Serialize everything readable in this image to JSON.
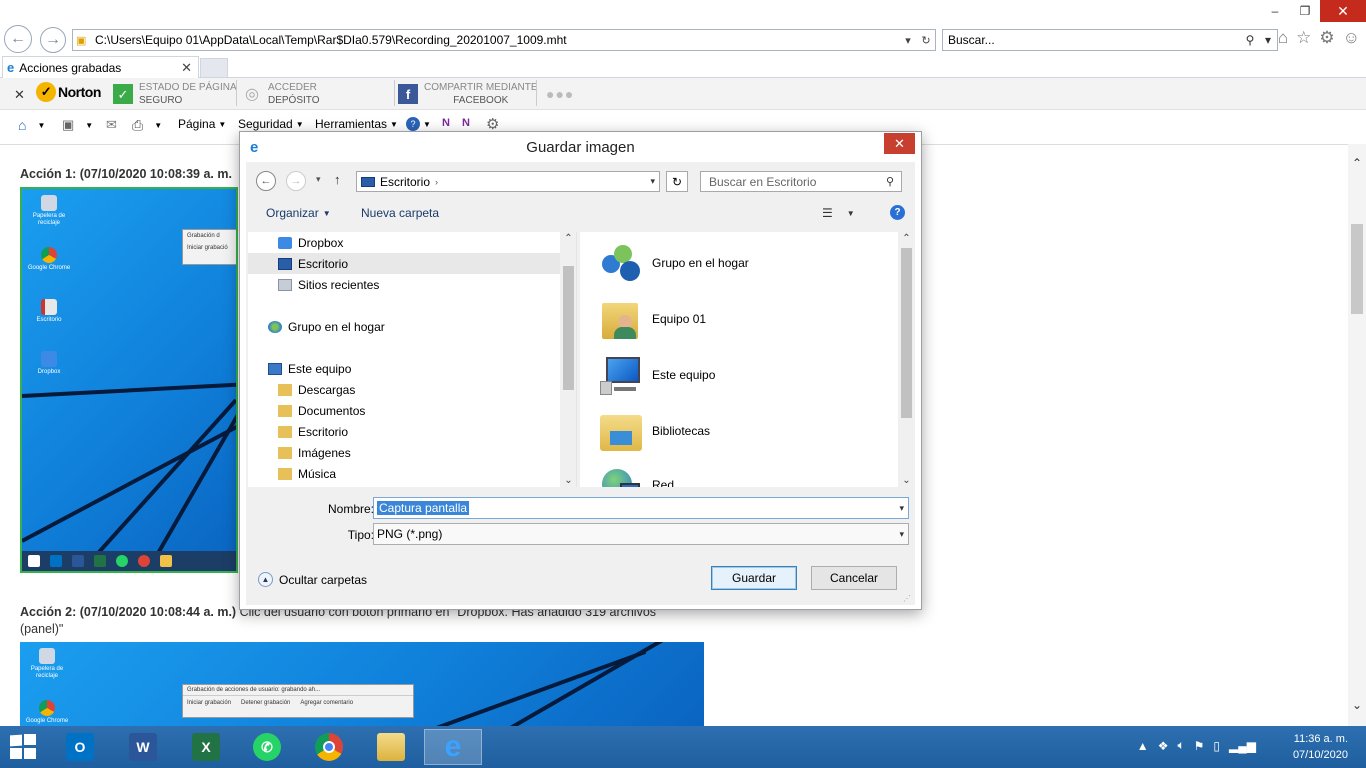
{
  "browser": {
    "address": "C:\\Users\\Equipo 01\\AppData\\Local\\Temp\\Rar$DIa0.579\\Recording_20201007_1009.mht",
    "search_placeholder": "Buscar...",
    "tab_title": "Acciones grabadas",
    "window_controls": {
      "minimize": "–",
      "maximize": "❐",
      "close": "✕"
    },
    "toolbar_icons": [
      "home-icon",
      "star-icon",
      "gear-icon",
      "smiley-icon"
    ]
  },
  "norton": {
    "logo_text": "Norton",
    "page_state_l1": "ESTADO DE PÁGINA",
    "page_state_l2": "SEGURO",
    "access_l1": "ACCEDER",
    "access_l2": "DEPÓSITO",
    "share_l1": "COMPARTIR MEDIANTE",
    "share_l2": "FACEBOOK",
    "accent": "#f4b400",
    "safe_color": "#3bab4a"
  },
  "commandbar": {
    "page": "Página",
    "security": "Seguridad",
    "tools": "Herramientas"
  },
  "content": {
    "action1_title": "Acción 1: (07/10/2020 10:08:39 a. m.",
    "action2_title": "Acción 2: (07/10/2020 10:08:44 a. m.)",
    "action2_rest": " Clic del usuario con botón primario en \"Dropbox. Has añadido 319 archivos",
    "action2_line2": "(panel)\"",
    "desk_icons": [
      "Papelera de reciclaje",
      "Google Chrome",
      "Escritorio",
      "Dropbox"
    ],
    "mini_rec1": "Grabación d",
    "mini_rec2": "Iniciar grabació",
    "mini_rec_title": "Grabación de acciones de usuario: grabando ah...",
    "mini_rec_start": "Iniciar grabación",
    "mini_rec_stop": "Detener grabación",
    "mini_rec_comment": "Agregar comentario"
  },
  "dialog": {
    "title": "Guardar imagen",
    "close": "✕",
    "breadcrumb": "Escritorio",
    "search_placeholder": "Buscar en Escritorio",
    "organize": "Organizar",
    "new_folder": "Nueva carpeta",
    "help": "?",
    "nav_items": [
      {
        "label": "Dropbox",
        "icon": "dropbox-icon"
      },
      {
        "label": "Escritorio",
        "icon": "desktop-icon"
      },
      {
        "label": "Sitios recientes",
        "icon": "recent-places-icon"
      },
      {
        "label": "Grupo en el hogar",
        "icon": "homegroup-icon"
      },
      {
        "label": "Este equipo",
        "icon": "computer-icon"
      },
      {
        "label": "Descargas",
        "icon": "folder-icon"
      },
      {
        "label": "Documentos",
        "icon": "folder-icon"
      },
      {
        "label": "Escritorio",
        "icon": "folder-icon"
      },
      {
        "label": "Imágenes",
        "icon": "folder-icon"
      },
      {
        "label": "Música",
        "icon": "folder-icon"
      }
    ],
    "files": [
      {
        "label": "Grupo en el hogar",
        "icon": "homegroup-icon"
      },
      {
        "label": "Equipo 01",
        "icon": "user-folder-icon"
      },
      {
        "label": "Este equipo",
        "icon": "computer-icon"
      },
      {
        "label": "Bibliotecas",
        "icon": "libraries-icon"
      },
      {
        "label": "Red",
        "icon": "network-icon"
      }
    ],
    "name_label": "Nombre:",
    "name_value": "Captura pantalla",
    "type_label": "Tipo:",
    "type_value": "PNG (*.png)",
    "hide_folders": "Ocultar carpetas",
    "save": "Guardar",
    "cancel": "Cancelar"
  },
  "taskbar": {
    "apps": [
      "outlook-icon",
      "word-icon",
      "excel-icon",
      "whatsapp-icon",
      "chrome-icon",
      "file-explorer-icon",
      "internet-explorer-icon"
    ],
    "time": "11:36 a. m.",
    "date": "07/10/2020"
  }
}
